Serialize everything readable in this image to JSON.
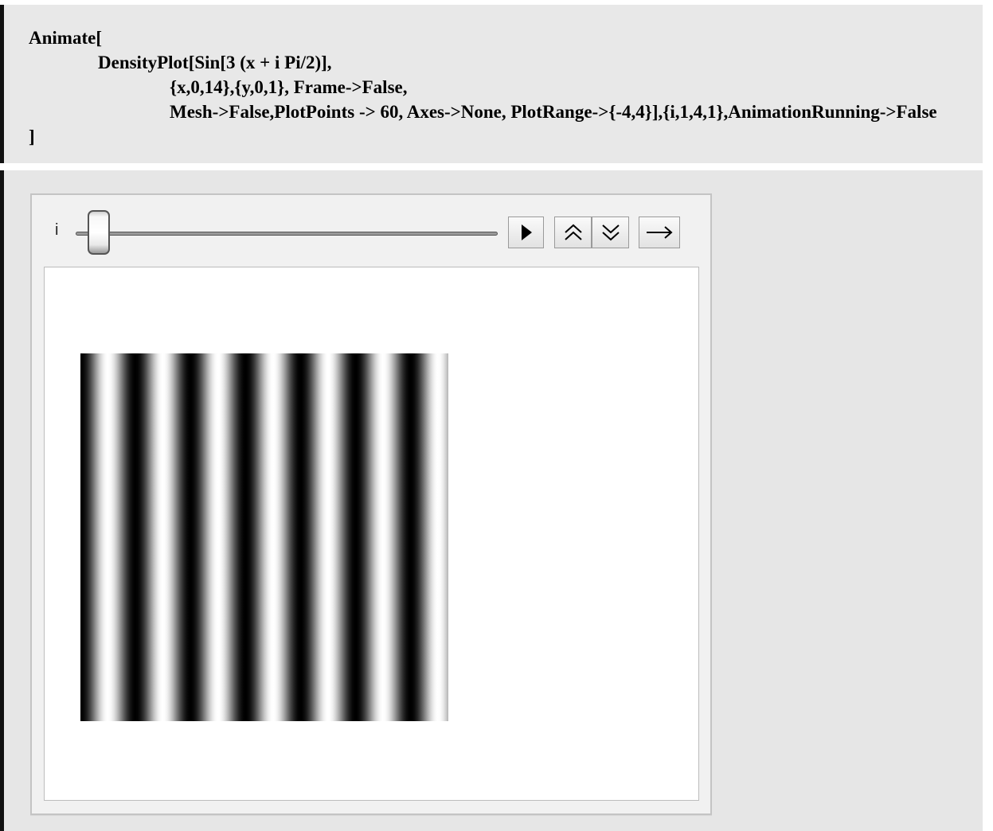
{
  "input_cell": {
    "code_lines": [
      "Animate[",
      "DensityPlot[Sin[3 (x + i Pi/2)],",
      "{x,0,14},{y,0,1}, Frame->False,",
      "Mesh->False,PlotPoints -> 60, Axes->None, PlotRange->{-4,4}],{i,1,4,1},AnimationRunning->False",
      "]"
    ]
  },
  "animator": {
    "variable_label": "i",
    "slider_value": 1,
    "slider_min": 1,
    "slider_max": 4,
    "slider_step": 1,
    "buttons": {
      "play_icon": "play-icon",
      "faster_icon": "double-chevron-up-icon",
      "slower_icon": "double-chevron-down-icon",
      "direction_icon": "arrow-right-icon"
    }
  },
  "chart_data": {
    "type": "heatmap",
    "function": "Sin[3 (x + i Pi/2)]",
    "i": 1,
    "x_range": [
      0,
      14
    ],
    "y_range": [
      0,
      1
    ],
    "plot_range": [
      -4,
      4
    ],
    "colormap": "grayscale",
    "frame": false,
    "axes": false
  },
  "colors": {
    "cell_background": "#e8e8e8",
    "cell_bracket": "#111111",
    "panel_background": "#f1f1f1",
    "plot_background": "#ffffff"
  }
}
